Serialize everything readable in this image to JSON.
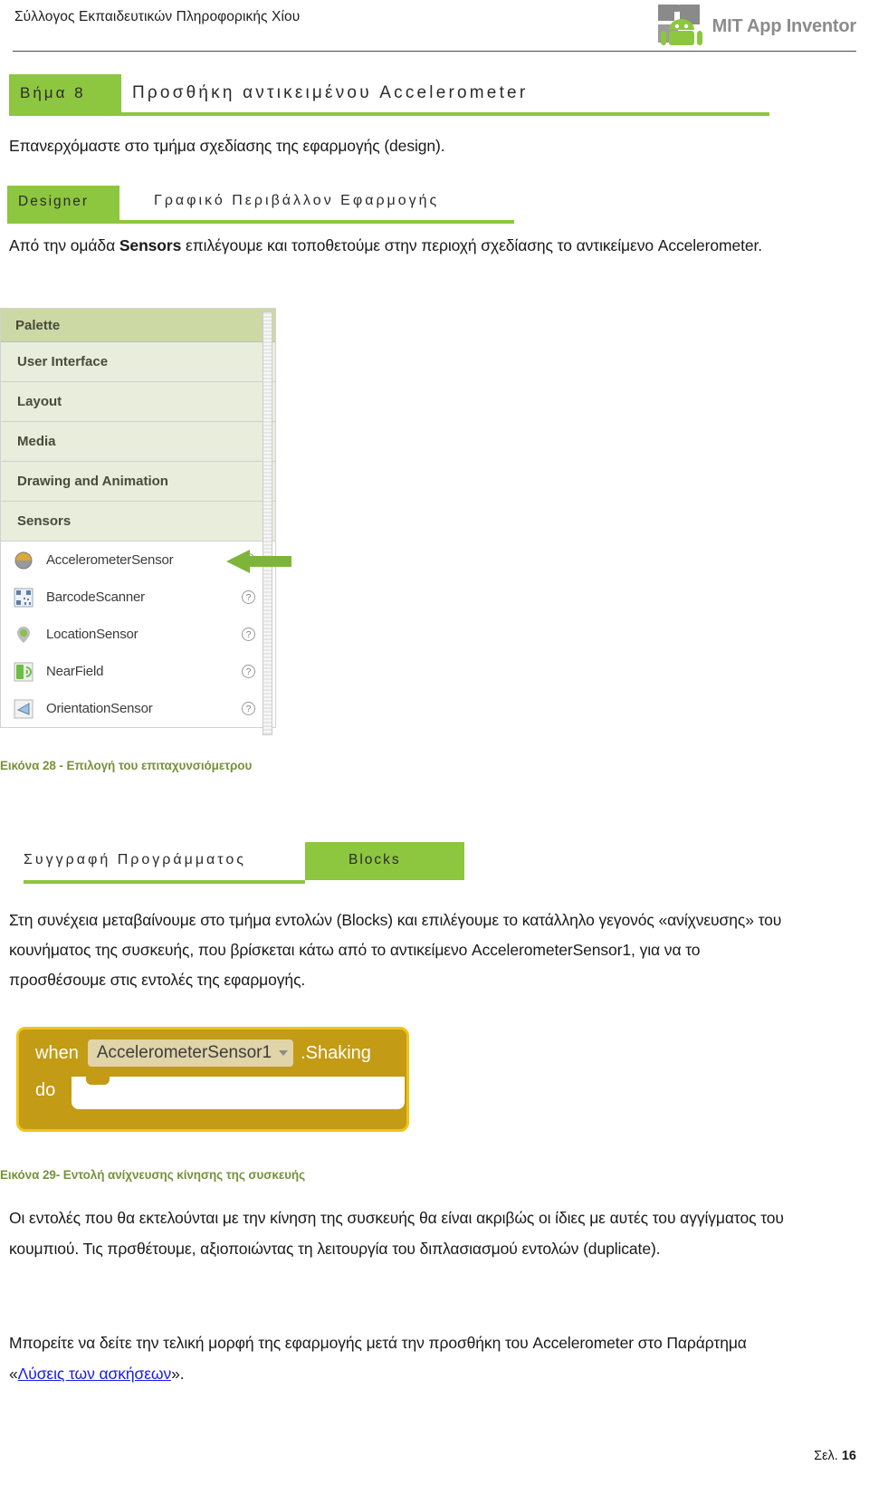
{
  "header": {
    "organization": "Σύλλογος Εκπαιδευτικών Πληροφορικής Χίου",
    "brand_name": "MIT App Inventor",
    "brand_icon": "android-robot-puzzle-icon"
  },
  "step": {
    "chip_label": "Βήμα 8",
    "title": "Προσθήκη αντικειμένου Accelerometer"
  },
  "intro_paragraph": "Επανερχόμαστε στο τμήμα σχεδίασης της εφαρμογής (design).",
  "designer_section": {
    "chip_label": "Designer",
    "title": "Γραφικό Περιβάλλον Εφαρμογής",
    "paragraph_prefix": "Από την ομάδα ",
    "paragraph_bold": "Sensors",
    "paragraph_suffix": " επιλέγουμε και τοποθετούμε στην περιοχή σχεδίασης το αντικείμενο Accelerometer."
  },
  "palette": {
    "title": "Palette",
    "categories": [
      "User Interface",
      "Layout",
      "Media",
      "Drawing and Animation",
      "Sensors"
    ],
    "components": [
      {
        "label": "AccelerometerSensor",
        "icon": "accelerometer-icon",
        "help": "?"
      },
      {
        "label": "BarcodeScanner",
        "icon": "barcode-icon",
        "help": "?"
      },
      {
        "label": "LocationSensor",
        "icon": "location-pin-icon",
        "help": "?"
      },
      {
        "label": "NearField",
        "icon": "nfc-icon",
        "help": "?"
      },
      {
        "label": "OrientationSensor",
        "icon": "orientation-icon",
        "help": "?"
      }
    ]
  },
  "figure28_caption": "Εικόνα 28 - Επιλογή του επιταχυνσιόμετρου",
  "blocks_section": {
    "title": "Συγγραφή Προγράμματος",
    "chip_label": "Blocks",
    "paragraph": "Στη συνέχεια μεταβαίνουμε στο τμήμα εντολών (Blocks) και επιλέγουμε το κατάλληλο γεγονός «ανίχνευσης» του κουνήματος της συσκευής, που βρίσκεται κάτω από το αντικείμενο AccelerometerSensor1, για να το προσθέσουμε στις εντολές της εφαρμογής."
  },
  "block": {
    "when_label": "when",
    "component": "AccelerometerSensor1",
    "event": ".Shaking",
    "do_label": "do",
    "caret_icon": "chevron-down-icon"
  },
  "figure29_caption": "Εικόνα 29- Εντολή ανίχνευσης κίνησης της συσκευής",
  "closing": {
    "paragraph1": "Οι εντολές που θα εκτελούνται με την κίνηση της συσκευής θα είναι ακριβώς οι ίδιες με αυτές του αγγίγματος του κουμπιού. Τις πρσθέτουμε, αξιοποιώντας τη λειτουργία του διπλασιασμού εντολών (duplicate).",
    "paragraph2_prefix": "Μπορείτε να δείτε την τελική μορφή της εφαρμογής μετά την προσθήκη του Accelerometer στο Παράρτημα «",
    "link_text": "Λύσεις των ασκήσεων",
    "paragraph2_suffix": "»."
  },
  "footer": {
    "page_prefix": "Σελ. ",
    "page_number": "16"
  },
  "colors": {
    "accent_green": "#8dc63f",
    "caption_green": "#76923c",
    "palette_header": "#ccd9a4",
    "palette_category": "#e8eedb",
    "block_gold": "#c39b14",
    "block_border": "#f0c419",
    "link_blue": "#1a1ae6"
  }
}
